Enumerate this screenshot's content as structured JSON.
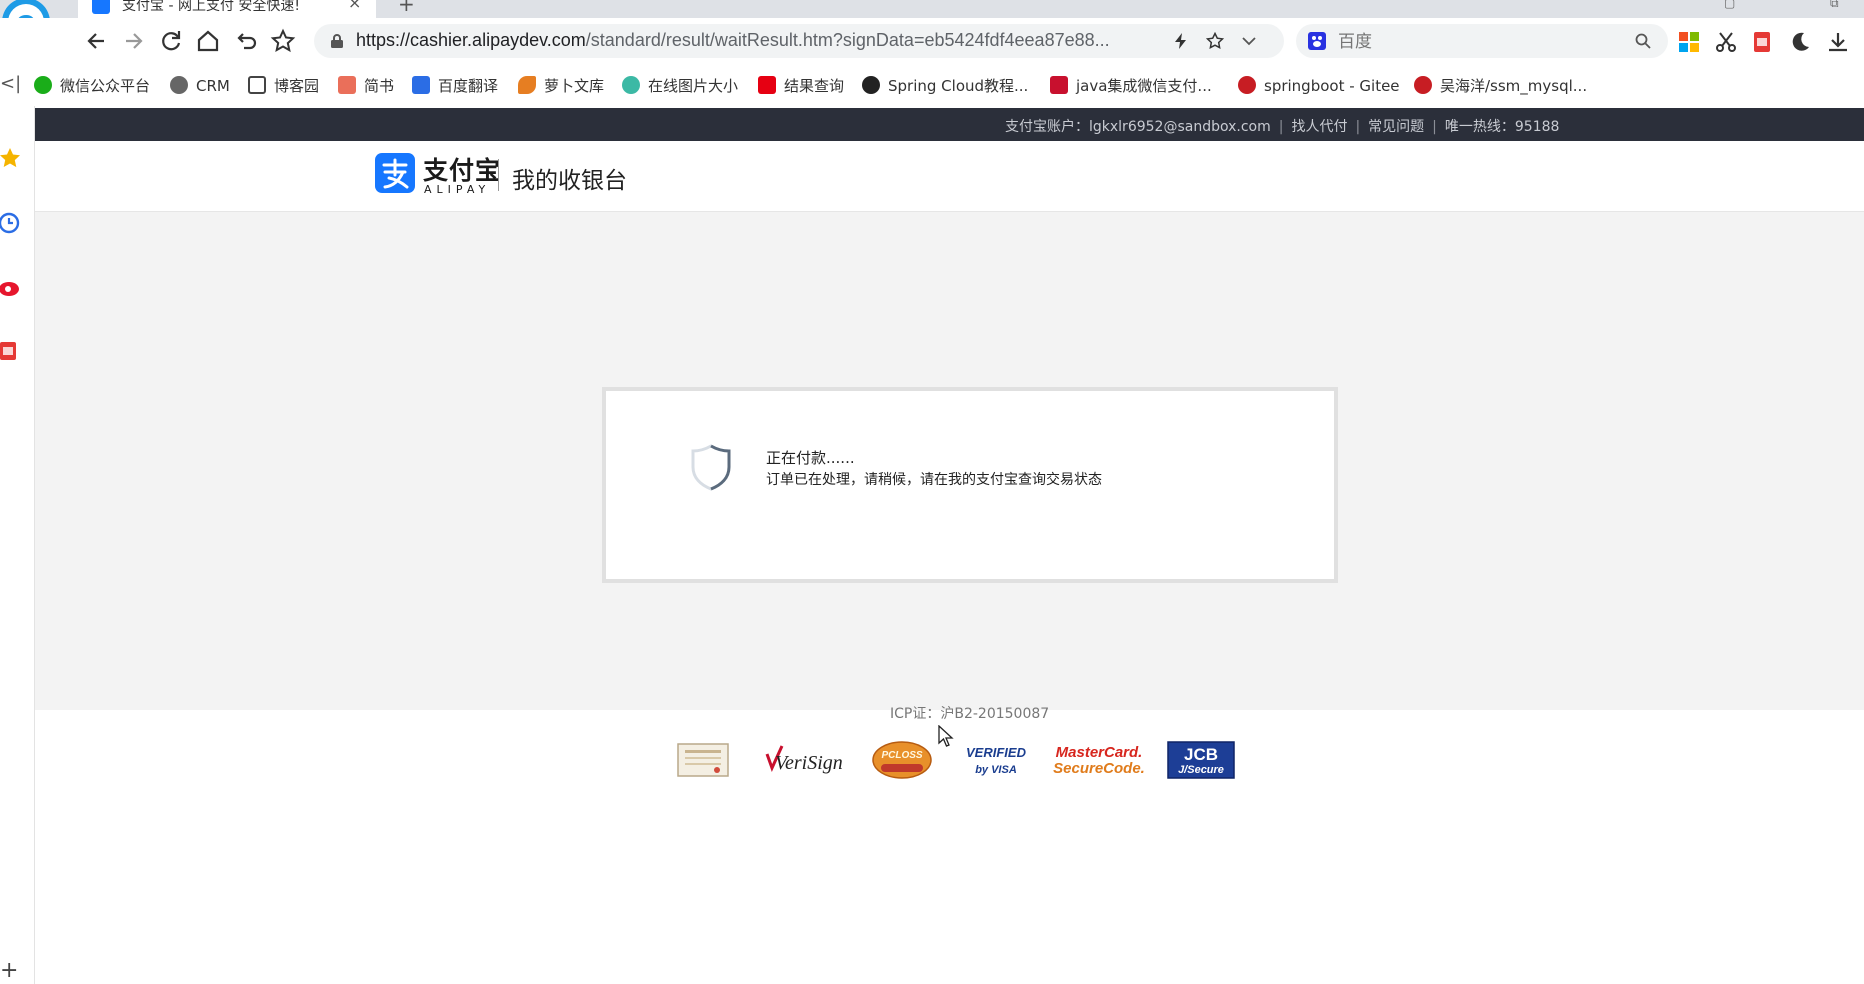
{
  "browser": {
    "tab_title": "支付宝 - 网上支付 安全快速!",
    "tab_close": "×",
    "new_tab": "+",
    "url_host": "https://cashier.alipaydev.com",
    "url_path": "/standard/result/waitResult.htm?signData=eb5424fdf4eea87e88...",
    "search_placeholder": "百度",
    "bookmarks": [
      {
        "label": "微信公众平台",
        "color": "#1aad19"
      },
      {
        "label": "CRM",
        "color": "#666666"
      },
      {
        "label": "博客园",
        "color": "#444444"
      },
      {
        "label": "简书",
        "color": "#ea6f5a"
      },
      {
        "label": "百度翻译",
        "color": "#2b6de5"
      },
      {
        "label": "萝卜文库",
        "color": "#e67e22"
      },
      {
        "label": "在线图片大小",
        "color": "#3cb9a5"
      },
      {
        "label": "结果查询",
        "color": "#e60012"
      },
      {
        "label": "Spring Cloud教程...",
        "color": "#222222"
      },
      {
        "label": "java集成微信支付...",
        "color": "#c8102e"
      },
      {
        "label": "springboot - Gitee",
        "color": "#c71d23"
      },
      {
        "label": "吴海洋/ssm_mysql...",
        "color": "#c71d23"
      }
    ]
  },
  "topbar": {
    "account": "支付宝账户：lgkxlr6952@sandbox.com",
    "link_pay_for_me": "找人代付",
    "link_faq": "常见问题",
    "hotline": "唯一热线：95188",
    "sep": "|"
  },
  "header": {
    "logo_cn": "支付宝",
    "logo_en": "ALIPAY",
    "title": "我的收银台"
  },
  "status": {
    "line1": "正在付款......",
    "line2": "订单已在处理，请稍候，请在我的支付宝查询交易状态"
  },
  "footer": {
    "icp": "ICP证：沪B2-20150087",
    "badge_verisign": "VeriSign",
    "badge_pcloss": "PCLOSS",
    "badge_visa_1": "VERIFIED",
    "badge_visa_2": "by VISA",
    "badge_mc_1": "MasterCard.",
    "badge_mc_2": "SecureCode.",
    "badge_jcb_1": "JCB",
    "badge_jcb_2": "J/Secure"
  },
  "colors": {
    "alipay_blue": "#1677ff",
    "topbar_bg": "#2b2f3a",
    "content_bg": "#f3f3f3"
  }
}
